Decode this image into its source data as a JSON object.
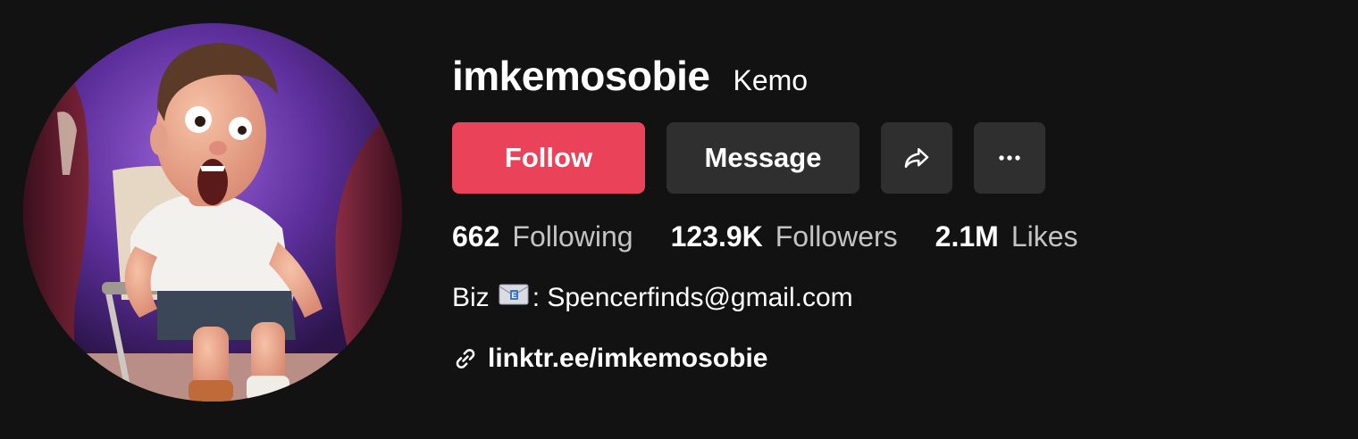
{
  "profile": {
    "username": "imkemosobie",
    "nickname": "Kemo",
    "avatar_icon": "cartoon-avatar"
  },
  "actions": {
    "follow_label": "Follow",
    "message_label": "Message",
    "share_icon": "share-icon",
    "more_icon": "more-icon"
  },
  "stats": {
    "following_count": "662",
    "following_label": "Following",
    "followers_count": "123.9K",
    "followers_label": "Followers",
    "likes_count": "2.1M",
    "likes_label": "Likes"
  },
  "bio": {
    "prefix": "Biz",
    "suffix": ": Spencerfinds@gmail.com"
  },
  "link": {
    "text": "linktr.ee/imkemosobie"
  },
  "colors": {
    "background": "#121212",
    "follow_button": "#ea4359",
    "secondary_button": "#2f2f2f"
  }
}
